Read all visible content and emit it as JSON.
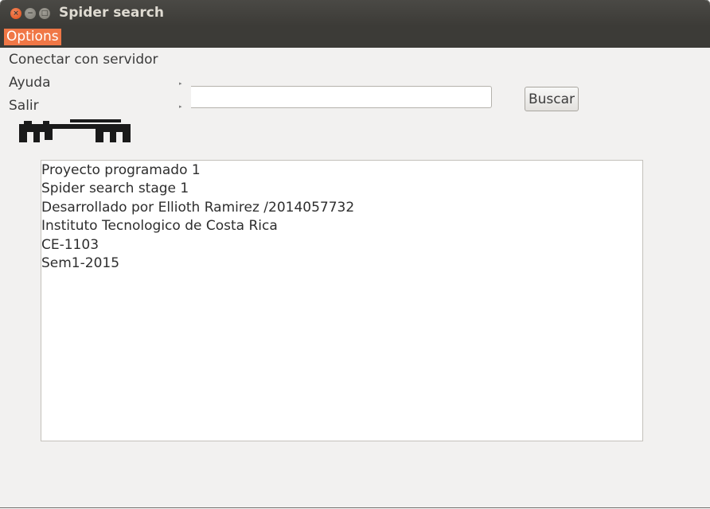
{
  "window": {
    "title": "Spider search",
    "controls": {
      "close": "×",
      "minimize": "−",
      "maximize": "□"
    }
  },
  "menubar": {
    "options_label": "Options"
  },
  "dropdown": {
    "items": [
      {
        "label": "Conectar con servidor",
        "has_submenu": false
      },
      {
        "label": "Ayuda",
        "has_submenu": true
      },
      {
        "label": "Salir",
        "has_submenu": true
      }
    ],
    "submenu_arrow": "▸"
  },
  "search": {
    "value": "",
    "placeholder": "",
    "button_label": "Buscar"
  },
  "logo": {
    "icon": "spider-logo-icon",
    "color": "#1a1a1a"
  },
  "content": {
    "lines": [
      "Proyecto programado 1",
      "Spider search stage 1",
      "Desarrollado por Ellioth Ramirez /2014057732",
      "Instituto Tecnologico de Costa Rica",
      "CE-1103",
      "Sem1-2015"
    ]
  },
  "colors": {
    "titlebar": "#3c3b37",
    "accent": "#f07746",
    "window_bg": "#f2f1f0"
  }
}
